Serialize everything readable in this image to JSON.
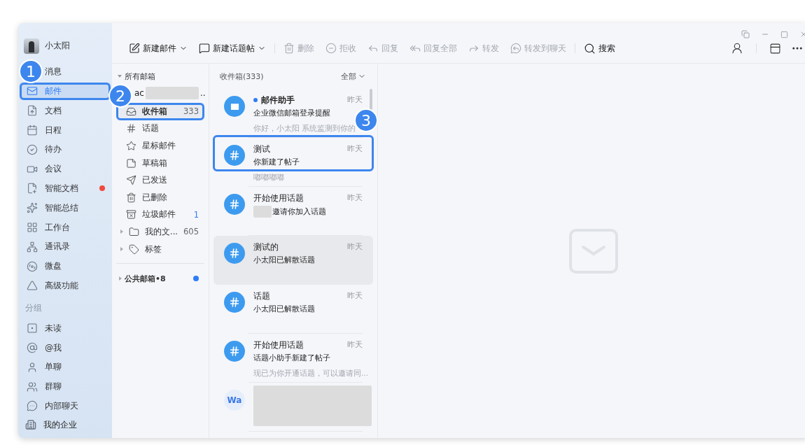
{
  "user": {
    "name": "小太阳"
  },
  "nav": [
    {
      "label": "消息",
      "selected": false
    },
    {
      "label": "邮件",
      "selected": true,
      "highlighted": true
    },
    {
      "label": "文档",
      "selected": false
    },
    {
      "label": "日程",
      "selected": false
    },
    {
      "label": "待办",
      "selected": false
    },
    {
      "label": "会议",
      "selected": false
    },
    {
      "label": "智能文档",
      "selected": false,
      "badge": true
    },
    {
      "label": "智能总结",
      "selected": false
    },
    {
      "label": "工作台",
      "selected": false
    },
    {
      "label": "通讯录",
      "selected": false
    },
    {
      "label": "微盘",
      "selected": false
    },
    {
      "label": "高级功能",
      "selected": false
    }
  ],
  "group_title": "分组",
  "groups": [
    {
      "label": "未读"
    },
    {
      "label": "@我"
    },
    {
      "label": "单聊"
    },
    {
      "label": "群聊"
    },
    {
      "label": "内部聊天"
    }
  ],
  "footer": {
    "label": "我的企业"
  },
  "toolbar": {
    "buttons": [
      {
        "label": "新建邮件",
        "dropdown": true,
        "disabled": false
      },
      {
        "label": "新建话题帖",
        "dropdown": true,
        "disabled": false
      },
      {
        "label": "删除",
        "dropdown": false,
        "disabled": true
      },
      {
        "label": "拒收",
        "dropdown": false,
        "disabled": true
      },
      {
        "label": "回复",
        "dropdown": false,
        "disabled": true
      },
      {
        "label": "回复全部",
        "dropdown": false,
        "disabled": true
      },
      {
        "label": "转发",
        "dropdown": false,
        "disabled": true
      },
      {
        "label": "转发到聊天",
        "dropdown": false,
        "disabled": true
      },
      {
        "label": "搜索",
        "dropdown": false,
        "disabled": false
      }
    ]
  },
  "folders": {
    "title": "所有邮箱",
    "account": "ac",
    "account_tail": "..",
    "items": [
      {
        "label": "收件箱",
        "count": "333",
        "selected": true,
        "highlighted": true
      },
      {
        "label": "话题",
        "selected": false
      },
      {
        "label": "星标邮件",
        "selected": false
      },
      {
        "label": "草稿箱",
        "selected": false
      },
      {
        "label": "已发送",
        "selected": false
      },
      {
        "label": "已删除",
        "selected": false
      },
      {
        "label": "垃圾邮件",
        "count": "1",
        "selected": false,
        "count_highlight": true
      },
      {
        "label": "我的文...",
        "count": "605",
        "selected": false,
        "expandable": true
      },
      {
        "label": "标签",
        "selected": false,
        "expandable": true
      }
    ],
    "public": {
      "label": "公共邮箱•8",
      "unread": true
    }
  },
  "list": {
    "title": "收件箱(333)",
    "filter": "全部",
    "items": [
      {
        "kind": "mail",
        "title": "邮件助手",
        "time": "昨天",
        "subject": "企业微信邮箱登录提醒",
        "preview": "你好，小太阳 系统监测到你的",
        "unread": true,
        "selected": false
      },
      {
        "kind": "topic",
        "title": "测试",
        "time": "昨天",
        "subject": "你新建了帖子",
        "preview": "嘟嘟嘟嘟",
        "unread": false,
        "selected": false,
        "highlighted": true
      },
      {
        "kind": "topic",
        "title": "开始使用话题",
        "time": "昨天",
        "subject": "邀请你加入话题",
        "subject_redacted": true,
        "unread": false,
        "selected": false
      },
      {
        "kind": "topic",
        "title": "测试的",
        "time": "昨天",
        "subject": "小太阳已解散话题",
        "unread": false,
        "selected": true
      },
      {
        "kind": "topic",
        "title": "话题",
        "time": "昨天",
        "subject": "小太阳已解散话题",
        "unread": false,
        "selected": false
      },
      {
        "kind": "topic",
        "title": "开始使用话题",
        "time": "昨天",
        "subject": "话题小助手新建了帖子",
        "preview": "现已为你开通话题，可以邀请同...",
        "unread": false,
        "selected": false
      },
      {
        "kind": "contact",
        "avatar": "Wa",
        "redacted": true,
        "unread": false,
        "selected": false
      }
    ]
  },
  "callouts": [
    {
      "number": "1"
    },
    {
      "number": "2"
    },
    {
      "number": "3"
    }
  ]
}
